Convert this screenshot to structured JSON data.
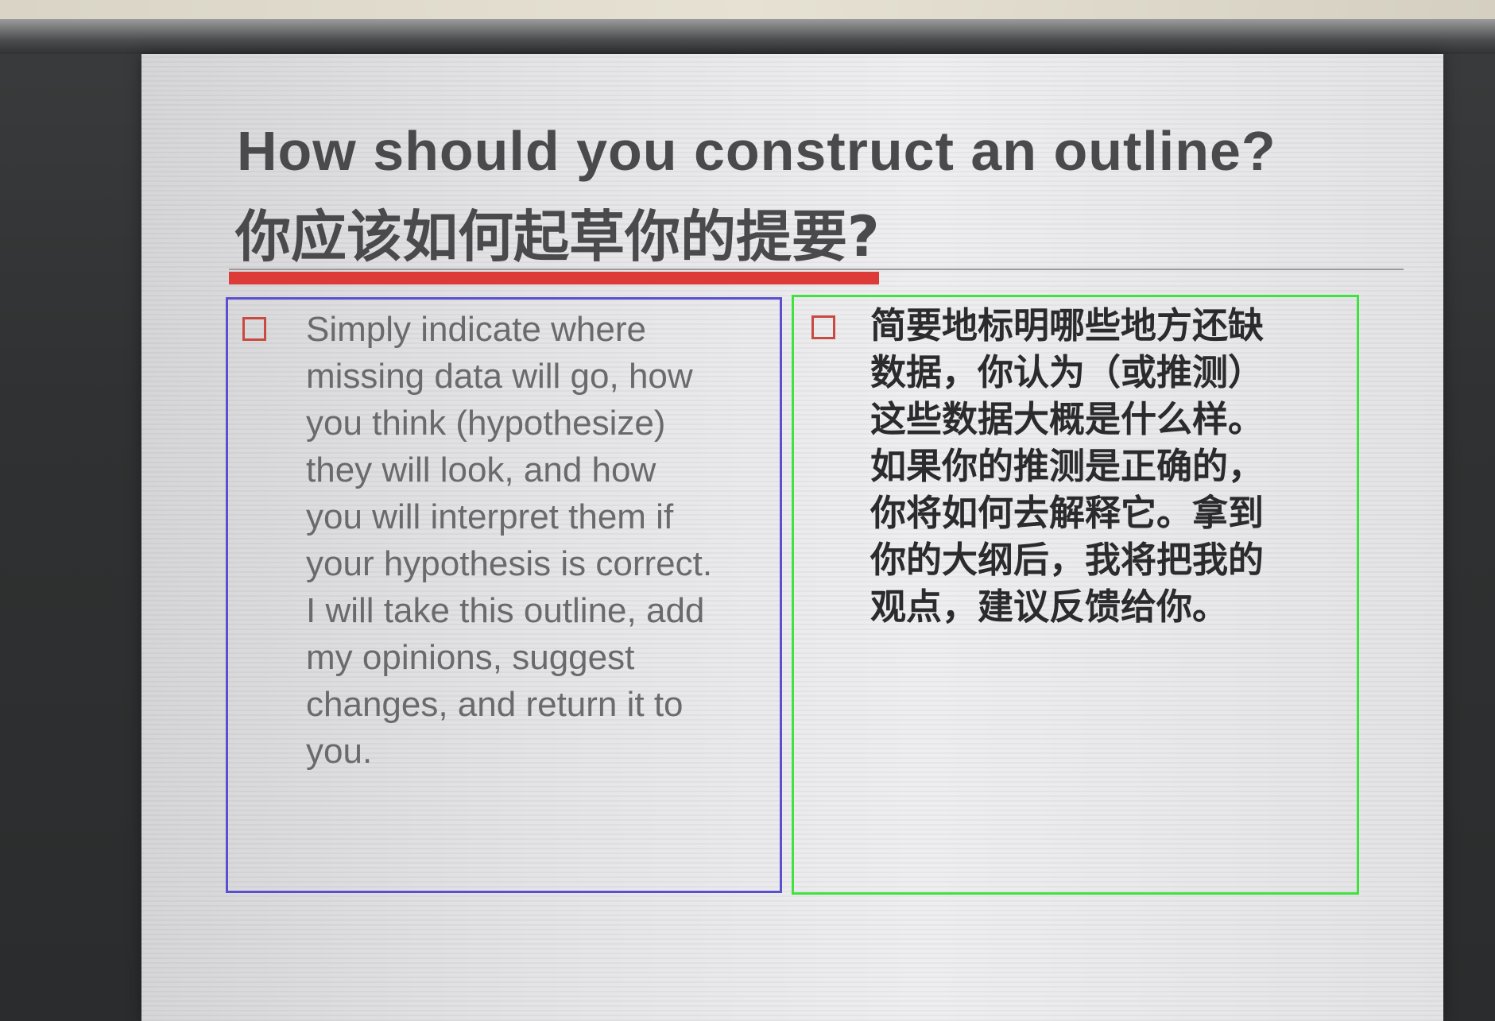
{
  "slide": {
    "title_en": "How should you construct an outline?",
    "title_zh": "你应该如何起草你的提要?",
    "left_column": {
      "lines": [
        "Simply indicate where",
        "missing data will go, how",
        "you think (hypothesize)",
        "they will look, and how",
        "you will interpret them if",
        "your hypothesis is correct.",
        "I will take this outline, add",
        "my opinions, suggest",
        "changes, and return it to",
        "you."
      ]
    },
    "right_column": {
      "lines": [
        "简要地标明哪些地方还缺",
        "数据，你认为（或推测）",
        "这些数据大概是什么样。",
        "如果你的推测是正确的，",
        "你将如何去解释它。拿到",
        "你的大纲后，我将把我的",
        "观点，建议反馈给你。"
      ]
    }
  },
  "colors": {
    "accent_red": "#dd3b37",
    "left_box_border": "#5a4fd0",
    "right_box_border": "#3fe33f",
    "title_text": "#4a4a4c"
  }
}
